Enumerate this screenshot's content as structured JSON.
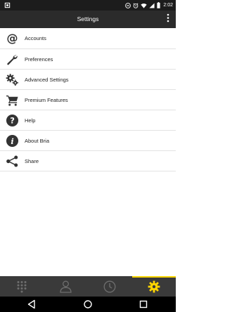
{
  "status_bar": {
    "time": "2:02",
    "icons": [
      "android-notification-icon",
      "dnd-icon",
      "alarm-icon",
      "wifi-icon",
      "cell-signal-icon",
      "battery-icon"
    ]
  },
  "app_bar": {
    "title": "Settings",
    "overflow_icon": "more-vert-icon"
  },
  "menu": {
    "items": [
      {
        "label": "Accounts",
        "icon": "at-sign-icon"
      },
      {
        "label": "Preferences",
        "icon": "wrench-icon"
      },
      {
        "label": "Advanced Settings",
        "icon": "gears-icon"
      },
      {
        "label": "Premium Features",
        "icon": "cart-icon"
      },
      {
        "label": "Help",
        "icon": "help-icon"
      },
      {
        "label": "About Bria",
        "icon": "info-icon"
      },
      {
        "label": "Share",
        "icon": "share-icon"
      }
    ]
  },
  "bottom_nav": {
    "tabs": [
      {
        "icon": "dialpad-icon",
        "active": false
      },
      {
        "icon": "contacts-icon",
        "active": false
      },
      {
        "icon": "history-icon",
        "active": false
      },
      {
        "icon": "settings-gear-icon",
        "active": true
      }
    ],
    "active_color": "#ffd500",
    "inactive_color": "#6e6e6e"
  },
  "system_nav": {
    "buttons": [
      "back-icon",
      "home-icon",
      "recents-icon"
    ]
  },
  "colors": {
    "app_bar": "#2b2b2b",
    "status_bar": "#1c1c1c",
    "bottom_nav": "#3a3a3a",
    "icon_gray": "#333333",
    "accent": "#ffd500"
  }
}
